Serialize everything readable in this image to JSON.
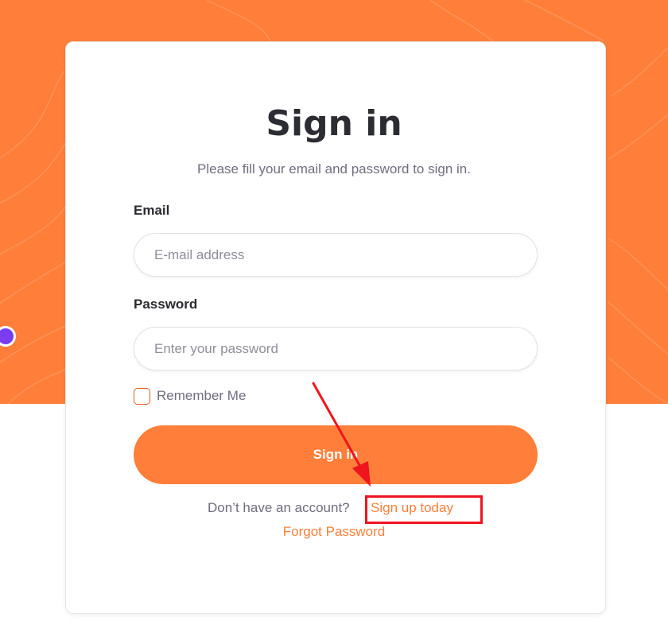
{
  "signin": {
    "title": "Sign in",
    "subtitle": "Please fill your email and password to sign in.",
    "email_label": "Email",
    "email_placeholder": "E-mail address",
    "email_value": "",
    "password_label": "Password",
    "password_placeholder": "Enter your password",
    "password_value": "",
    "remember_label": "Remember Me",
    "remember_checked": false,
    "submit_label": "Sign in",
    "signup_prompt": "Don’t have an account?",
    "signup_link": "Sign up today",
    "forgot_link": "Forgot Password"
  },
  "colors": {
    "accent": "#ff7f3a",
    "annotation": "#f0141e",
    "dot": "#7a3cf0"
  },
  "icons": {
    "checkbox": "checkbox-unchecked-icon",
    "annotation_arrow": "arrow-icon"
  }
}
